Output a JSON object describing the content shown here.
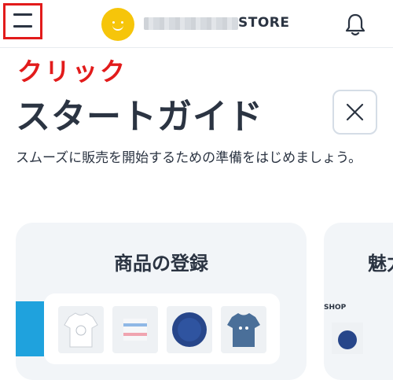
{
  "header": {
    "store_name": "STORE",
    "icons": [
      "menu-icon",
      "logo-icon",
      "bell-icon"
    ]
  },
  "annotation": {
    "click_label": "クリック",
    "color": "#e21b1b"
  },
  "guide": {
    "title": "スタートガイド",
    "description": "スムーズに販売を開始するための準備をはじめましょう。",
    "close_icon": "close-icon"
  },
  "cards": [
    {
      "title": "商品の登録"
    },
    {
      "title": "魅力",
      "label": "SHOP"
    }
  ],
  "colors": {
    "text": "#2b3442",
    "logo": "#f6c50a",
    "card_bg": "#f2f5f8",
    "accent_blue": "#1fa2dd"
  }
}
